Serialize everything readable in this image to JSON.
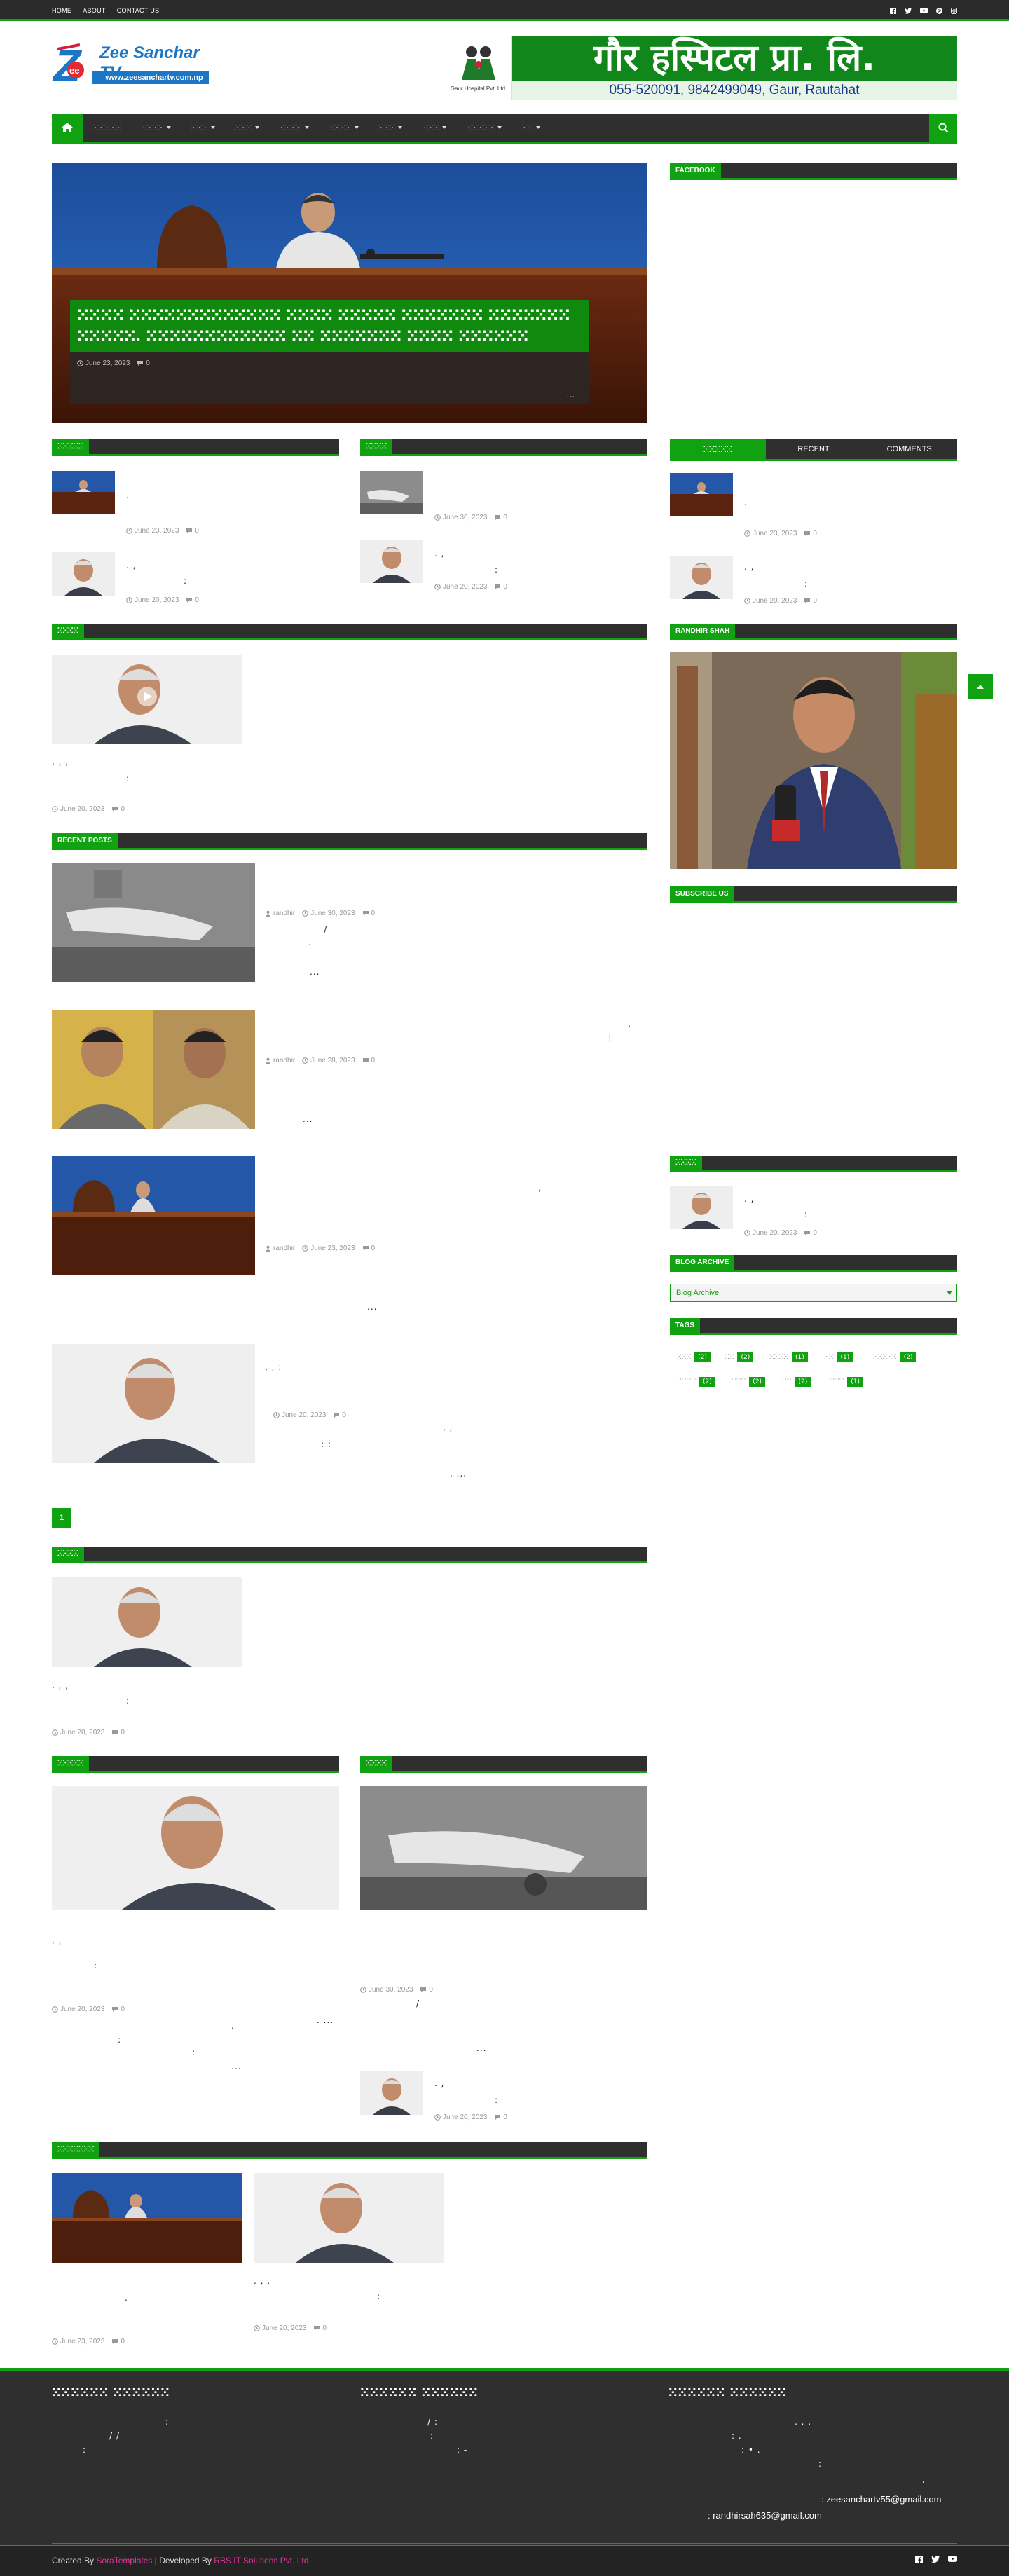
{
  "topbar": {
    "links": [
      "HOME",
      "ABOUT",
      "CONTACT US"
    ],
    "social_icons": [
      "facebook-icon",
      "twitter-icon",
      "youtube-icon",
      "pinterest-icon",
      "instagram-icon"
    ]
  },
  "logo": {
    "brand": "Zee Sanchar TV",
    "url": "www.zeesanchartv.com.np",
    "mark": "Z"
  },
  "banner": {
    "title": "गौर हस्पिटल प्रा. लि.",
    "phone": "055-520091, 9842499049, Gaur, Rautahat",
    "mini_label": "Gaur Hospital Pvt. Ltd."
  },
  "nav": {
    "items": [
      {
        "label": "ⵘⵘⵘⵘⵘ",
        "dropdown": false
      },
      {
        "label": "ⵘⵘⵘⵘ",
        "dropdown": true
      },
      {
        "label": "ⵘⵘⵘ",
        "dropdown": true
      },
      {
        "label": "ⵘⵘⵘ",
        "dropdown": true
      },
      {
        "label": "ⵘⵘⵘⵘ",
        "dropdown": true
      },
      {
        "label": "ⵘⵘⵘⵘ",
        "dropdown": true
      },
      {
        "label": "ⵘⵘⵘ",
        "dropdown": true
      },
      {
        "label": "ⵘⵘⵘ",
        "dropdown": true
      },
      {
        "label": "ⵘⵘⵘⵘⵘ",
        "dropdown": true
      },
      {
        "label": "ⵘⵘ",
        "dropdown": true
      }
    ]
  },
  "hero": {
    "title": "ⵘⵘⵘⵘ ⵘⵘⵘⵘⵘⵘⵘⵘⵘⵘⵘⵘⵘ ⵘⵘⵘⵘ ⵘⵘⵘⵘⵘ ⵘⵘⵘⵘⵘⵘⵘ ⵘⵘⵘⵘⵘⵘⵘ ⵘⵘⵘⵘⵘ. ⵘⵘⵘⵘⵘⵘⵘⵘⵘⵘⵘⵘ ⵘⵘ ⵘⵘⵘⵘⵘⵘⵘ ⵘⵘⵘⵘ ⵘⵘⵘⵘⵘⵘ",
    "date": "June 23, 2023",
    "comments": "0",
    "dots": "..."
  },
  "sections": {
    "col1_label": "ⵘⵘⵘⵘⵘ",
    "col2_label": "ⵘⵘⵘⵘ",
    "video_label": "ⵘⵘⵘⵘ",
    "recent_label": "RECENT POSTS",
    "bottom_label": "ⵘⵘⵘⵘ",
    "bottom_col1_label": "ⵘⵘⵘⵘⵘ",
    "bottom_col2_label": "ⵘⵘⵘⵘ",
    "last_label": "ⵘⵘⵘⵘⵘⵘⵘ"
  },
  "col1_posts": [
    {
      "date": "June 23, 2023",
      "comments": "0"
    },
    {
      "date": "June 20, 2023",
      "comments": "0"
    }
  ],
  "col2_posts": [
    {
      "date": "June 30, 2023",
      "comments": "0"
    },
    {
      "date": "June 20, 2023",
      "comments": "0"
    }
  ],
  "video_post": {
    "date": "June 20, 2023",
    "comments": "0"
  },
  "recent_posts": [
    {
      "author": "randhir",
      "date": "June 30, 2023",
      "comments": "0"
    },
    {
      "author": "randhir",
      "date": "June 28, 2023",
      "comments": "0"
    },
    {
      "author": "randhir",
      "date": "June 23, 2023",
      "comments": "0"
    },
    {
      "author": "",
      "date": "June 20, 2023",
      "comments": "0"
    }
  ],
  "pagination": {
    "current": "1"
  },
  "bottom_post": {
    "date": "June 20, 2023",
    "comments": "0"
  },
  "bottom_col1_post": {
    "date": "June 20, 2023",
    "comments": "0"
  },
  "bottom_col2_posts": [
    {
      "date": "June 30, 2023",
      "comments": "0"
    },
    {
      "date": "June 20, 2023",
      "comments": "0"
    }
  ],
  "last_posts": [
    {
      "date": "June 23, 2023",
      "comments": "0"
    },
    {
      "date": "June 20, 2023",
      "comments": "0"
    }
  ],
  "sidebar": {
    "facebook_label": "FACEBOOK",
    "tabs": [
      "ⵘⵘⵘⵘⵘ",
      "RECENT",
      "COMMENTS"
    ],
    "tab_posts": [
      {
        "date": "June 23, 2023",
        "comments": "0"
      },
      {
        "date": "June 20, 2023",
        "comments": "0"
      }
    ],
    "randhir_label": "RANDHIR SHAH",
    "subscribe_label": "SUBSCRIBE US",
    "popular_label": "ⵘⵘⵘⵘ",
    "popular_post": {
      "date": "June 20, 2023",
      "comments": "0"
    },
    "archive_label": "BLOG ARCHIVE",
    "archive_select": "Blog Archive",
    "tags_label": "TAGS",
    "tags": [
      {
        "name": "ⵘⵘⵘ",
        "count": "(2)"
      },
      {
        "name": "ⵘⵘ",
        "count": "(2)"
      },
      {
        "name": "ⵘⵘⵘⵘ",
        "count": "(1)"
      },
      {
        "name": "ⵘⵘ",
        "count": "(1)"
      },
      {
        "name": "ⵘⵘⵘⵘⵘ",
        "count": "(2)"
      },
      {
        "name": "ⵘⵘⵘⵘ",
        "count": "(2)"
      },
      {
        "name": "ⵘⵘⵘ",
        "count": "(2)"
      },
      {
        "name": "ⵘⵘ",
        "count": "(2)"
      },
      {
        "name": "ⵘⵘⵘ",
        "count": "(1)"
      }
    ]
  },
  "footer": {
    "headings": [
      "ⵘⵘⵘⵘⵘⵘ ⵘⵘⵘⵘⵘⵘ",
      "ⵘⵘⵘⵘⵘⵘ ⵘⵘⵘⵘⵘⵘ",
      "ⵘⵘⵘⵘⵘⵘ ⵘⵘⵘⵘⵘⵘ"
    ],
    "email1": ": zeesanchartv55@gmail.com",
    "email2": ": randhirsah635@gmail.com",
    "credit_prefix": "Created By ",
    "credit_brand": "SoraTemplates",
    "credit_mid": " | Developed By ",
    "credit_dev": "RBS IT Solutions Pvt. Ltd."
  },
  "colors": {
    "accent": "#11a211",
    "dark": "#2f2f2f",
    "footer": "#2f2f2f"
  }
}
